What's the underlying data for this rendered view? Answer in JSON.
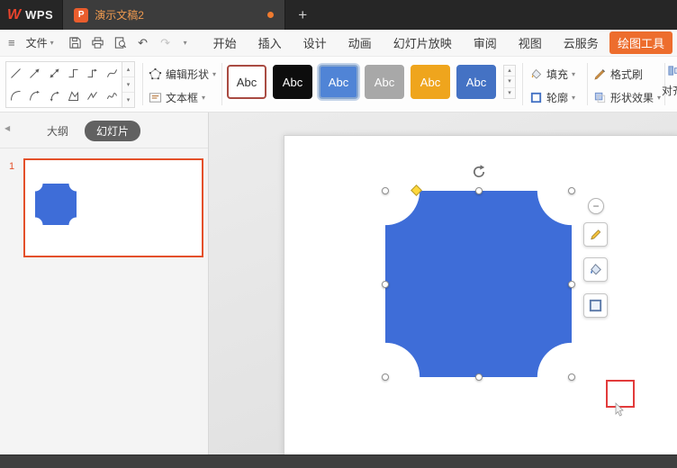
{
  "icons": {
    "wps_logo": "W",
    "presentation_file": "P",
    "hamburger": "≡",
    "chevron_down": "▾",
    "chevron_up": "▴",
    "more_bar": "—",
    "undo": "↶",
    "redo": "↷",
    "minus": "−",
    "collapse_left": "◀",
    "gallery_icon_names": [
      "line-icon",
      "arrow-icon",
      "double-arrow-icon",
      "elbow-connector-icon",
      "elbow-arrow-icon",
      "curve-icon",
      "curved-connector-icon",
      "curved-arrow-icon",
      "curved-double-arrow-icon",
      "freeform-shape-icon",
      "freeform-line-icon",
      "scribble-icon"
    ]
  },
  "titlebar": {
    "app_name": "WPS",
    "tab_title": "演示文稿2",
    "new_tab_label": "+"
  },
  "menubar": {
    "file_label": "文件",
    "tabs": [
      "开始",
      "插入",
      "设计",
      "动画",
      "幻灯片放映",
      "审阅",
      "视图",
      "云服务"
    ],
    "context_tab": "绘图工具"
  },
  "toolbar": {
    "edit_shape": "编辑形状",
    "text_box": "文本框",
    "selected_style_index": 2,
    "styles": [
      {
        "label": "Abc",
        "css": "background:#ffffff;color:#333333;border-color:#a94b42"
      },
      {
        "label": "Abc",
        "css": "background:#0d0d0d;color:#ffffff;border-color:#0d0d0d"
      },
      {
        "label": "Abc",
        "css": "background:#5084d6;color:#ffffff;border-color:#87a6cf"
      },
      {
        "label": "Abc",
        "css": "background:#a8a8a8;color:#ffffff;border-color:#a8a8a8"
      },
      {
        "label": "Abc",
        "css": "background:#efa51d;color:#ffffff;border-color:#efa51d"
      },
      {
        "label": "Abc",
        "css": "background:#4472c4;color:#ffffff;border-color:#4472c4"
      }
    ],
    "fill": "填充",
    "outline": "轮廓",
    "format_painter": "格式刷",
    "shape_effects": "形状效果",
    "align": "对齐"
  },
  "left_panel": {
    "outline_tab": "大纲",
    "slides_tab": "幻灯片",
    "slide_number": "1"
  },
  "canvas": {
    "shape_fill": "#3e6dd8"
  },
  "colors": {
    "accent_orange": "#ed6d2d",
    "selection_border": "#e4502a",
    "annotation_red": "#e23b3b"
  }
}
